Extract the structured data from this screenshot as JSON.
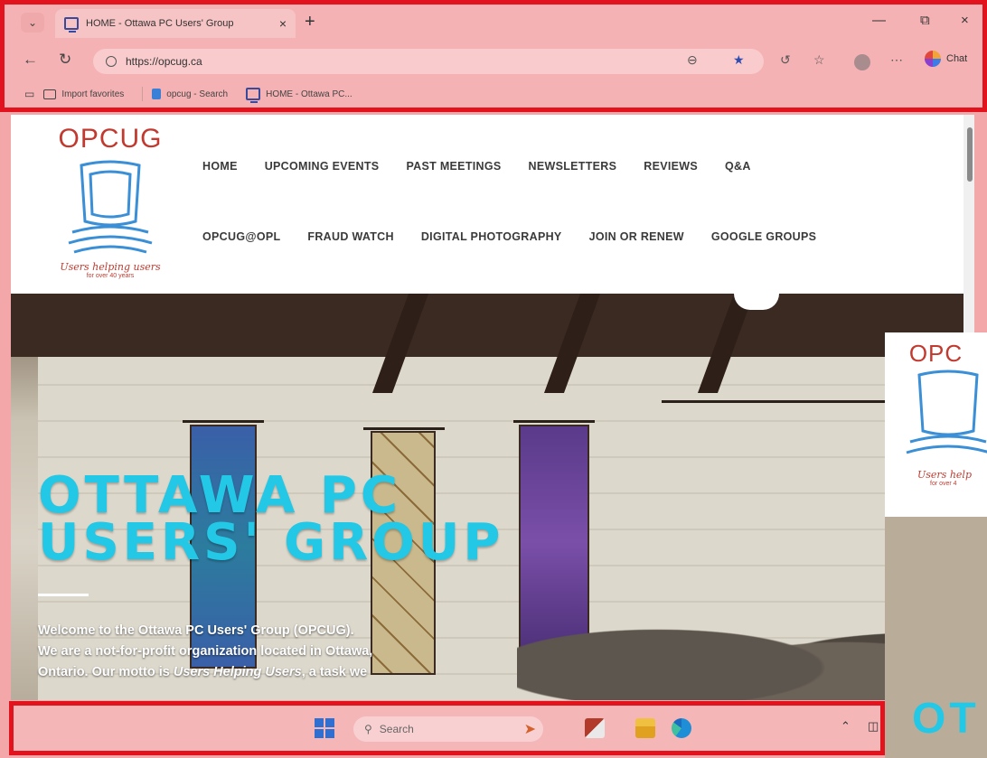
{
  "browser": {
    "tab_title": "HOME - Ottawa PC Users' Group",
    "url": "https://opcug.ca",
    "chat_label": "Chat",
    "favorites": [
      {
        "label": "Import favorites",
        "icon": "folder-icon"
      },
      {
        "label": "opcug - Search",
        "icon": "bing-icon"
      },
      {
        "label": "HOME - Ottawa PC...",
        "icon": "page-icon"
      }
    ]
  },
  "site": {
    "logo_title": "OPCUG",
    "logo_motto": "Users helping users",
    "logo_sub": "for over 40 years",
    "menu_row1": [
      "HOME",
      "UPCOMING EVENTS",
      "PAST MEETINGS",
      "NEWSLETTERS",
      "REVIEWS",
      "Q&A"
    ],
    "menu_row2": [
      "OPCUG@OPL",
      "FRAUD WATCH",
      "DIGITAL PHOTOGRAPHY",
      "JOIN OR RENEW",
      "GOOGLE GROUPS"
    ],
    "hero_title_line1": "OTTAWA PC",
    "hero_title_line2": "USERS' GROUP",
    "hero_text_1": "Welcome to the Ottawa PC Users' Group (OPCUG).",
    "hero_text_2": "We are a not-for-profit organization located in Ottawa,",
    "hero_text_3a": "Ontario. Our motto is ",
    "hero_text_3b": "Users Helping Users",
    "hero_text_3c": ", a task we"
  },
  "overlay": {
    "logo_title": "OPC",
    "logo_motto": "Users help",
    "logo_sub": "for over 4",
    "hero_partial": "OT"
  },
  "taskbar": {
    "search_placeholder": "Search"
  },
  "colors": {
    "highlight_border": "#e3131d",
    "hero_title": "#22c8e6",
    "logo_red": "#c23a2f"
  }
}
